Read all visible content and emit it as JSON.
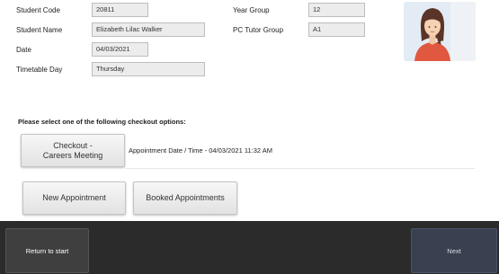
{
  "student": {
    "code_label": "Student Code",
    "code_value": "20811",
    "name_label": "Student Name",
    "name_value": "Elizabeth Lilac Walker",
    "date_label": "Date",
    "date_value": "04/03/2021",
    "day_label": "Timetable Day",
    "day_value": "Thursday",
    "year_label": "Year Group",
    "year_value": "12",
    "tutor_label": "PC Tutor Group",
    "tutor_value": "A1"
  },
  "photo": {
    "icon": "student-avatar-icon"
  },
  "checkout": {
    "prompt": "Please select one of the following checkout options:",
    "option_label": "Checkout - Careers Meeting",
    "appointment_text": "Appointment Date / Time - 04/03/2021 11:32 AM"
  },
  "actions": {
    "new_label": "New Appointment",
    "booked_label": "Booked Appointments"
  },
  "footer": {
    "back_label": "Return to start",
    "next_label": "Next"
  }
}
